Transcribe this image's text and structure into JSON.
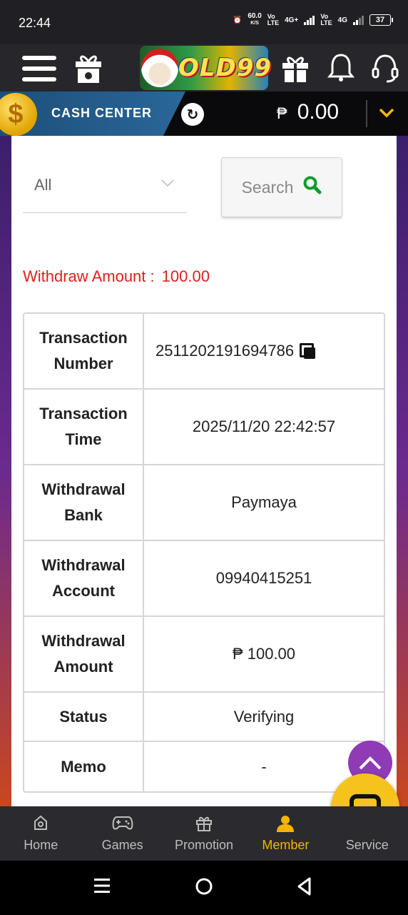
{
  "status_bar": {
    "time": "22:44",
    "speed_value": "60.0",
    "speed_unit": "K/S",
    "net1_top": "Vo",
    "net1_bottom": "LTE",
    "net1_gen": "4G+",
    "net2_top": "Vo",
    "net2_bottom": "LTE",
    "net2_gen": "4G",
    "battery": "37"
  },
  "header": {
    "logo_text": "GOLD99",
    "icons": [
      "menu-icon",
      "gift-box-icon",
      "gift-icon",
      "bell-icon",
      "headset-icon"
    ]
  },
  "cash_center": {
    "title": "CASH CENTER",
    "currency_symbol": "₱",
    "balance": "0.00"
  },
  "filter": {
    "selected": "All",
    "search_label": "Search"
  },
  "withdraw": {
    "label": "Withdraw Amount :",
    "value": "100.00"
  },
  "details": [
    {
      "label": "Transaction Number",
      "value": "2511202191694786"
    },
    {
      "label": "Transaction Time",
      "value": "2025/11/20 22:42:57"
    },
    {
      "label": "Withdrawal Bank",
      "value": "Paymaya"
    },
    {
      "label": "Withdrawal Account",
      "value": "09940415251"
    },
    {
      "label": "Withdrawal Amount",
      "value": "₱ 100.00"
    },
    {
      "label": "Status",
      "value": "Verifying"
    },
    {
      "label": "Memo",
      "value": "-"
    }
  ],
  "bottom_nav": [
    {
      "label": "Home",
      "icon": "home-icon",
      "active": false
    },
    {
      "label": "Games",
      "icon": "gamepad-icon",
      "active": false
    },
    {
      "label": "Promotion",
      "icon": "gift-icon",
      "active": false
    },
    {
      "label": "Member",
      "icon": "user-icon",
      "active": true
    },
    {
      "label": "Service",
      "icon": "headset-icon",
      "active": false
    }
  ],
  "colors": {
    "accent": "#f4b400",
    "alert_red": "#e0201a",
    "search_green": "#0b9c2a",
    "fab_purple": "#8e3bb5"
  }
}
